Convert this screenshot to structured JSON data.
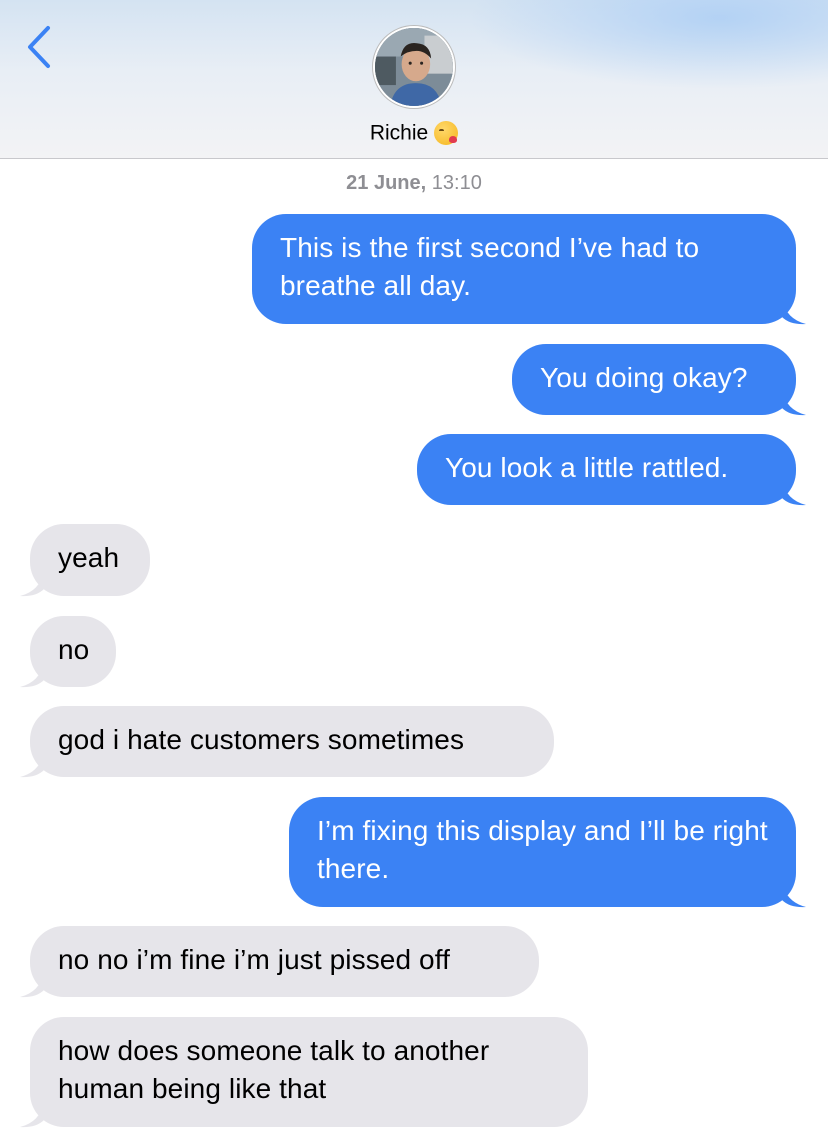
{
  "header": {
    "contact_name": "Richie",
    "contact_emoji": "face-blowing-a-kiss-icon",
    "back_icon": "chevron-left-icon"
  },
  "conversation": {
    "timestamp_date": "21 June,",
    "timestamp_time": "13:10",
    "messages": [
      {
        "direction": "sent",
        "text": "This is the first second I’ve had to breathe all day."
      },
      {
        "direction": "sent",
        "text": "You doing okay?"
      },
      {
        "direction": "sent",
        "text": "You look a little rattled."
      },
      {
        "direction": "received",
        "text": "yeah"
      },
      {
        "direction": "received",
        "text": "no"
      },
      {
        "direction": "received",
        "text": "god i hate customers sometimes"
      },
      {
        "direction": "sent",
        "text": "I’m fixing this display and I’ll be right there."
      },
      {
        "direction": "received",
        "text": "no no i’m fine i’m just pissed off"
      },
      {
        "direction": "received",
        "text": "how does someone talk to another human being like that"
      }
    ]
  },
  "colors": {
    "sent_bubble": "#3b82f4",
    "received_bubble": "#e6e5ea",
    "accent": "#3b82f4"
  }
}
